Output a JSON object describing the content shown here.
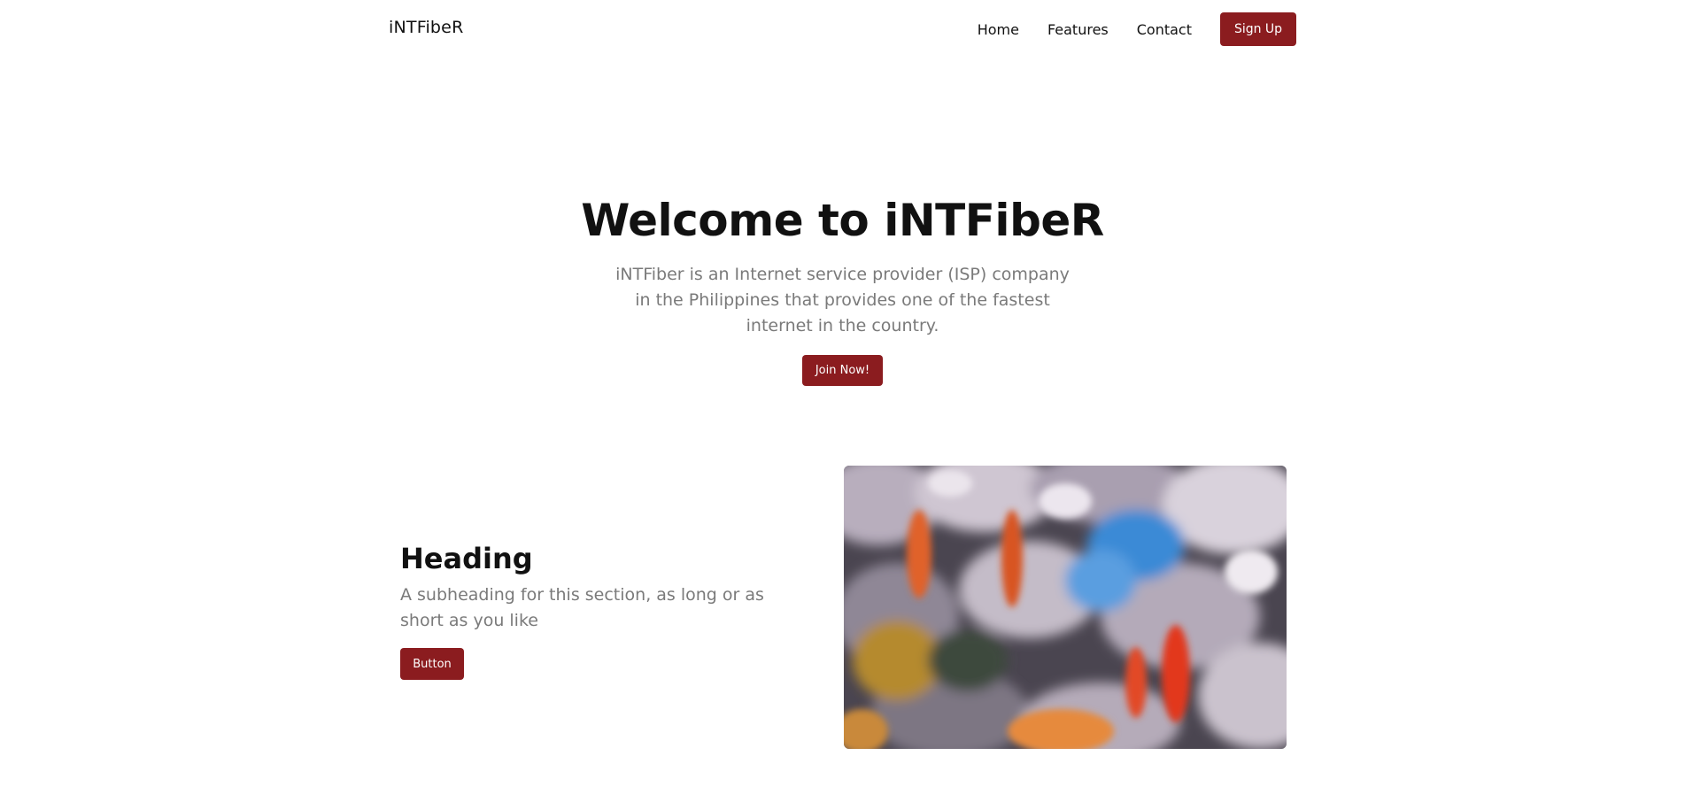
{
  "nav": {
    "brand": "iNTFibeR",
    "links": [
      "Home",
      "Features",
      "Contact"
    ],
    "signup_label": "Sign Up"
  },
  "hero": {
    "title": "Welcome to iNTFibeR",
    "subtitle": "iNTFiber is an Internet service provider (ISP) company in the Philippines that provides one of the fastest internet in the country.",
    "button_label": "Join Now!"
  },
  "feature": {
    "title": "Heading",
    "subtitle": "A subheading for this section, as long or as short as you like",
    "button_label": "Button",
    "image": "blurred-aerial-trees-photo"
  },
  "colors": {
    "accent": "#8b1c1f",
    "muted_text": "#7a7a7a"
  }
}
